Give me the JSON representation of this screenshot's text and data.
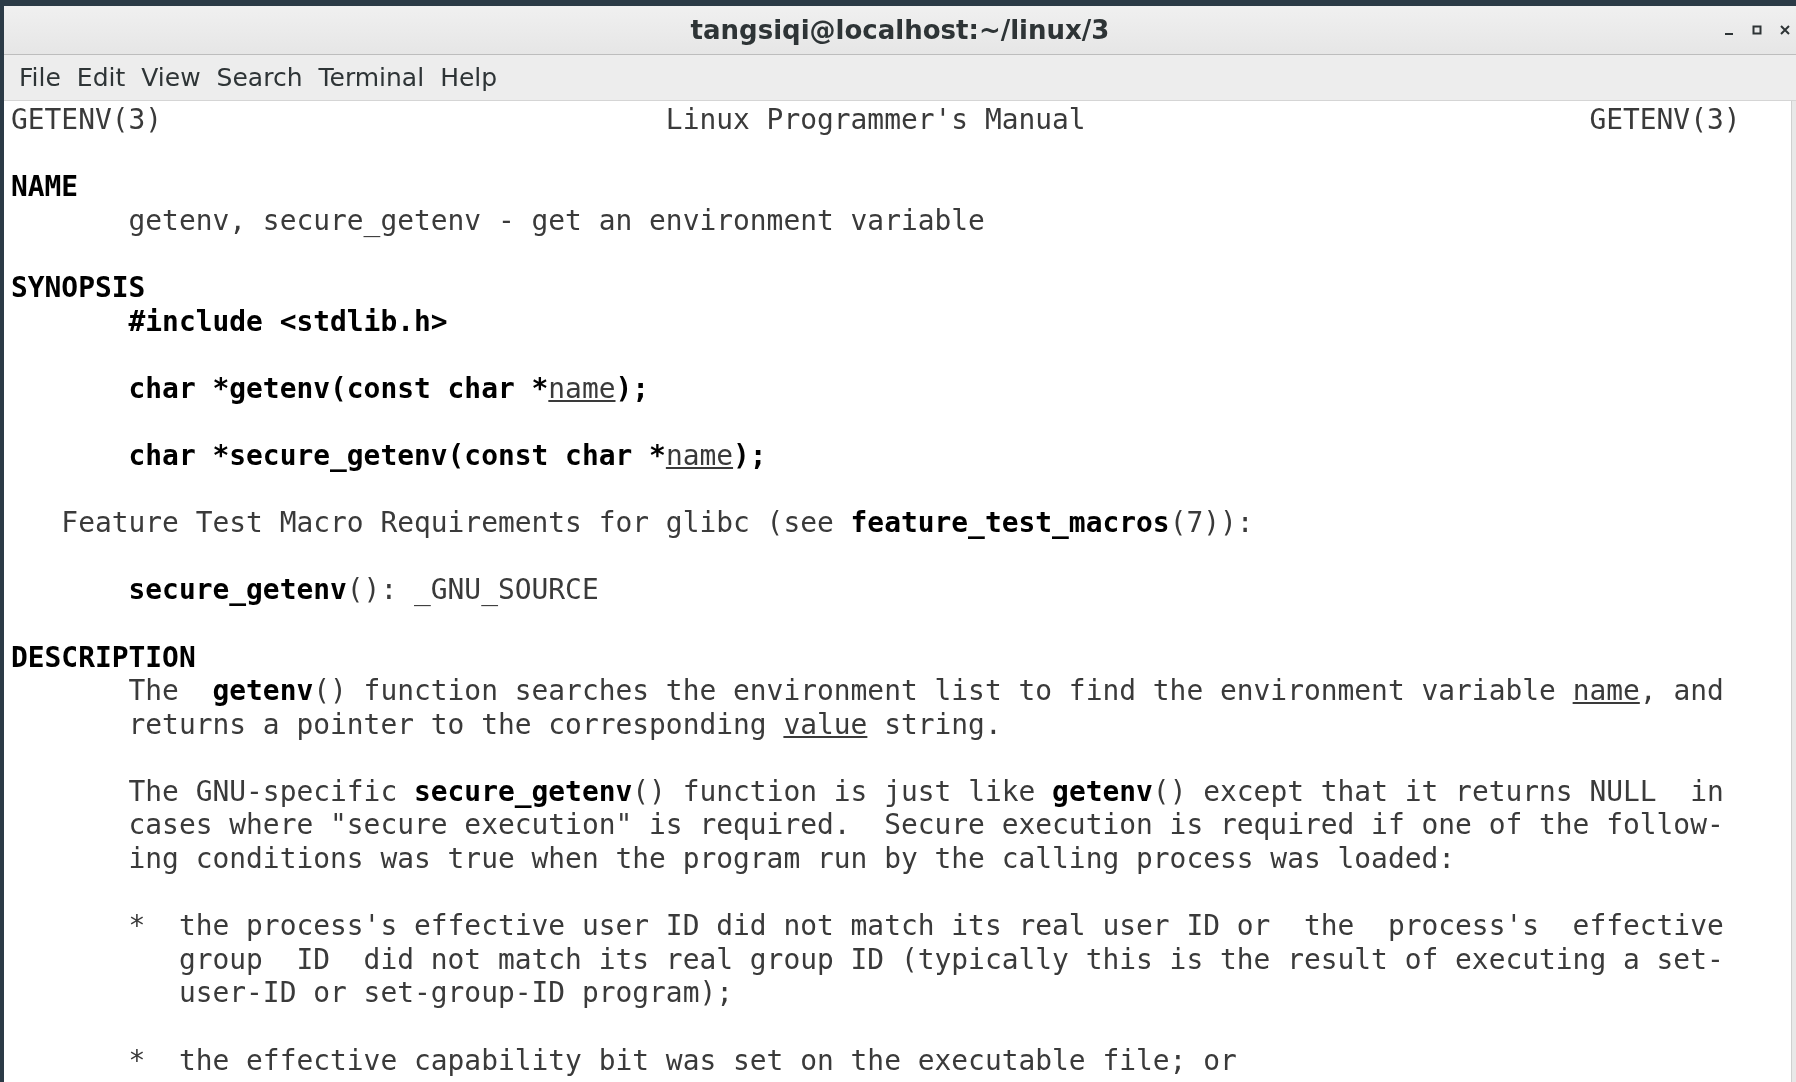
{
  "window": {
    "title": "tangsiqi@localhost:~/linux/3"
  },
  "menu": [
    "File",
    "Edit",
    "View",
    "Search",
    "Terminal",
    "Help"
  ],
  "header": {
    "left": "GETENV(3)",
    "center": "Linux Programmer's Manual",
    "right": "GETENV(3)"
  },
  "blocks": [
    {
      "lines": [
        {
          "kind": "heading",
          "segments": [
            {
              "kind": "literal",
              "text": "NAME"
            }
          ]
        },
        {
          "kind": "body",
          "segments": [
            {
              "kind": "text",
              "text": "getenv, secure_getenv - get an environment variable"
            }
          ]
        }
      ]
    },
    {
      "lines": [
        {
          "kind": "heading",
          "segments": [
            {
              "kind": "literal",
              "text": "SYNOPSIS"
            }
          ]
        },
        {
          "kind": "body",
          "segments": [
            {
              "kind": "literal",
              "text": "#include <stdlib.h>"
            }
          ]
        }
      ]
    },
    {
      "lines": [
        {
          "kind": "body",
          "segments": [
            {
              "kind": "literal",
              "text": "char *getenv(const char *"
            },
            {
              "kind": "argument",
              "text": "name"
            },
            {
              "kind": "literal",
              "text": ");"
            }
          ]
        }
      ]
    },
    {
      "lines": [
        {
          "kind": "body",
          "segments": [
            {
              "kind": "literal",
              "text": "char *secure_getenv(const char *"
            },
            {
              "kind": "argument",
              "text": "name"
            },
            {
              "kind": "literal",
              "text": ");"
            }
          ]
        }
      ]
    },
    {
      "lines": [
        {
          "kind": "note",
          "segments": [
            {
              "kind": "text",
              "text": "Feature Test Macro Requirements for glibc (see "
            },
            {
              "kind": "literal",
              "text": "feature_test_macros"
            },
            {
              "kind": "text",
              "text": "(7)):"
            }
          ]
        }
      ]
    },
    {
      "lines": [
        {
          "kind": "body",
          "segments": [
            {
              "kind": "literal",
              "text": "secure_getenv"
            },
            {
              "kind": "text",
              "text": "(): _GNU_SOURCE"
            }
          ]
        }
      ]
    },
    {
      "lines": [
        {
          "kind": "heading",
          "segments": [
            {
              "kind": "literal",
              "text": "DESCRIPTION"
            }
          ]
        },
        {
          "kind": "body",
          "segments": [
            {
              "kind": "text",
              "text": "The  "
            },
            {
              "kind": "literal",
              "text": "getenv"
            },
            {
              "kind": "text",
              "text": "() function searches the environment list to find the environment variable "
            },
            {
              "kind": "argument",
              "text": "name"
            },
            {
              "kind": "text",
              "text": ", and"
            }
          ]
        },
        {
          "kind": "body",
          "segments": [
            {
              "kind": "text",
              "text": "returns a pointer to the corresponding "
            },
            {
              "kind": "argument",
              "text": "value"
            },
            {
              "kind": "text",
              "text": " string."
            }
          ]
        }
      ]
    },
    {
      "lines": [
        {
          "kind": "body",
          "segments": [
            {
              "kind": "text",
              "text": "The GNU-specific "
            },
            {
              "kind": "literal",
              "text": "secure_getenv"
            },
            {
              "kind": "text",
              "text": "() function is just like "
            },
            {
              "kind": "literal",
              "text": "getenv"
            },
            {
              "kind": "text",
              "text": "() except that it returns NULL  in"
            }
          ]
        },
        {
          "kind": "body",
          "segments": [
            {
              "kind": "text",
              "text": "cases where \"secure execution\" is required.  Secure execution is required if one of the follow-"
            }
          ]
        },
        {
          "kind": "body",
          "segments": [
            {
              "kind": "text",
              "text": "ing conditions was true when the program run by the calling process was loaded:"
            }
          ]
        }
      ]
    },
    {
      "lines": [
        {
          "kind": "body",
          "segments": [
            {
              "kind": "text",
              "text": "*  the process's effective user ID did not match its real user ID or  the  process's  effective"
            }
          ]
        },
        {
          "kind": "hang",
          "segments": [
            {
              "kind": "text",
              "text": "group  ID  did not match its real group ID (typically this is the result of executing a set-"
            }
          ]
        },
        {
          "kind": "hang",
          "segments": [
            {
              "kind": "text",
              "text": "user-ID or set-group-ID program);"
            }
          ]
        }
      ]
    },
    {
      "lines": [
        {
          "kind": "body",
          "segments": [
            {
              "kind": "text",
              "text": "*  the effective capability bit was set on the executable file; or"
            }
          ]
        }
      ]
    }
  ]
}
